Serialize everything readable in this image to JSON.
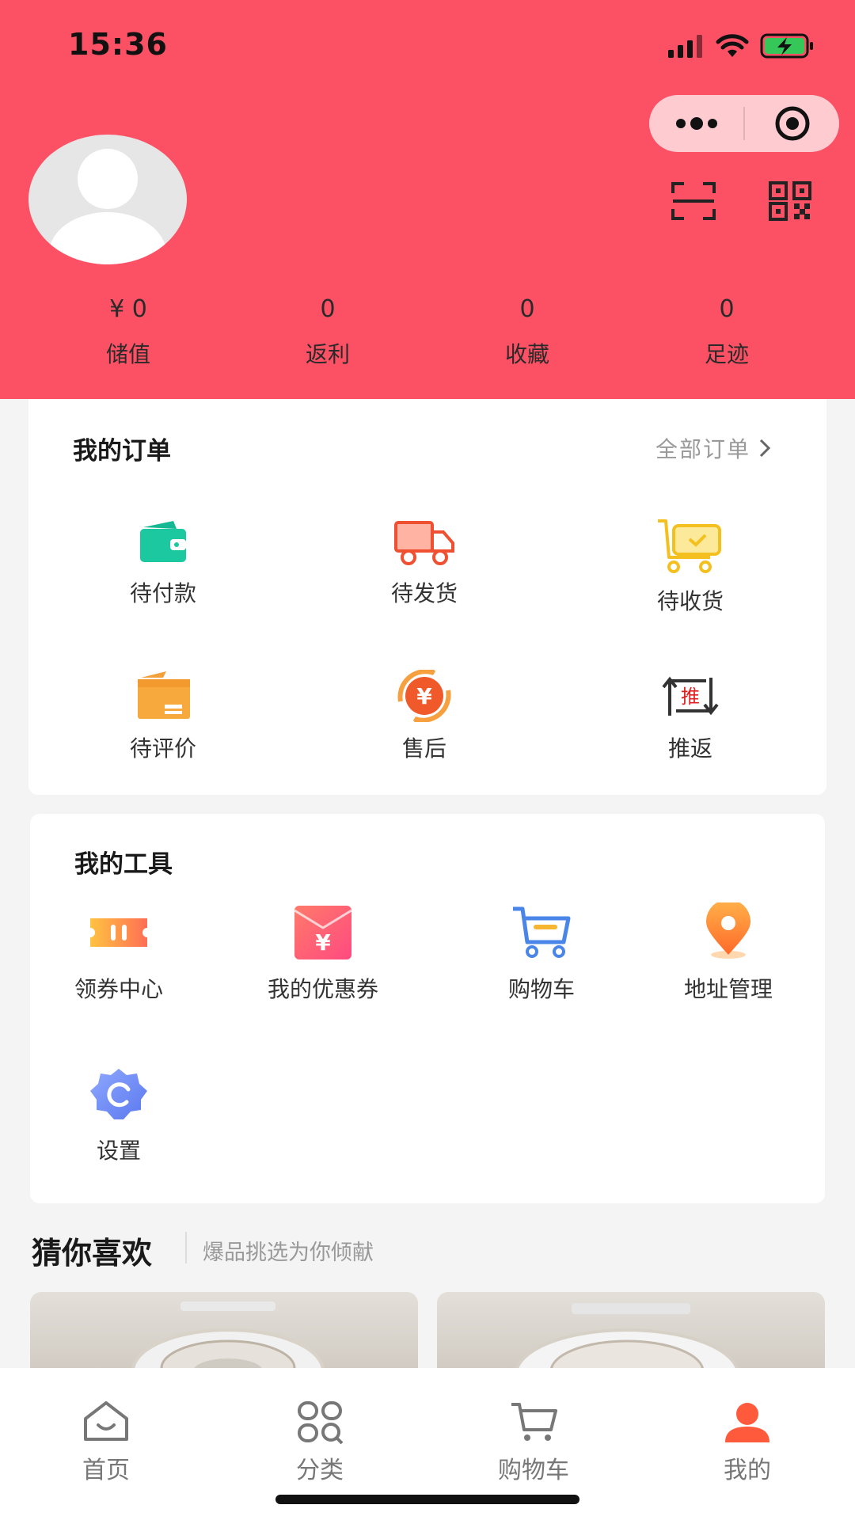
{
  "status": {
    "time": "15:36"
  },
  "profile": {
    "stats": [
      {
        "value": "¥ 0",
        "label": "储值"
      },
      {
        "value": "0",
        "label": "返利"
      },
      {
        "value": "0",
        "label": "收藏"
      },
      {
        "value": "0",
        "label": "足迹"
      }
    ]
  },
  "orders": {
    "title": "我的订单",
    "all_label": "全部订单",
    "items": [
      {
        "label": "待付款",
        "icon": "wallet-icon"
      },
      {
        "label": "待发货",
        "icon": "truck-icon"
      },
      {
        "label": "待收货",
        "icon": "delivery-cart-icon"
      },
      {
        "label": "待评价",
        "icon": "package-icon"
      },
      {
        "label": "售后",
        "icon": "yen-refresh-icon"
      },
      {
        "label": "推返",
        "icon": "push-return-icon",
        "badge": "推"
      }
    ]
  },
  "tools": {
    "title": "我的工具",
    "items": [
      {
        "label": "领券中心",
        "icon": "ticket-icon"
      },
      {
        "label": "我的优惠券",
        "icon": "red-envelope-icon",
        "glyph": "¥"
      },
      {
        "label": "购物车",
        "icon": "cart-icon"
      },
      {
        "label": "地址管理",
        "icon": "location-pin-icon"
      },
      {
        "label": "设置",
        "icon": "settings-gear-icon"
      }
    ]
  },
  "recommend": {
    "title": "猜你喜欢",
    "subtitle": "爆品挑选为你倾献"
  },
  "tabbar": {
    "items": [
      {
        "label": "首页",
        "icon": "home-icon"
      },
      {
        "label": "分类",
        "icon": "category-icon"
      },
      {
        "label": "购物车",
        "icon": "cart-icon"
      },
      {
        "label": "我的",
        "icon": "user-icon",
        "active": true
      }
    ]
  },
  "colors": {
    "header": "#fc5064",
    "accent": "#ff5a3c"
  }
}
